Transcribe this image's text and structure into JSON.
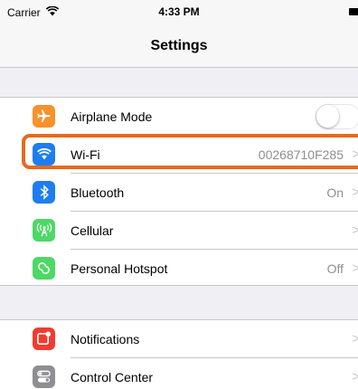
{
  "status_bar": {
    "carrier": "Carrier",
    "time": "4:33 PM"
  },
  "nav": {
    "title": "Settings"
  },
  "colors": {
    "highlight": "#e8691d",
    "airplane": "#f7922d",
    "wifi": "#1e7df2",
    "bluetooth": "#1e7df2",
    "cellular": "#4cd964",
    "hotspot": "#4cd964",
    "notifications": "#f23b30",
    "control_center": "#8e8e93"
  },
  "group1": [
    {
      "label": "Airplane Mode",
      "icon": "airplane-icon",
      "control": "toggle-off"
    },
    {
      "label": "Wi-Fi",
      "icon": "wifi-icon",
      "detail": "00268710F285"
    },
    {
      "label": "Bluetooth",
      "icon": "bluetooth-icon",
      "detail": "On"
    },
    {
      "label": "Cellular",
      "icon": "cellular-antenna-icon",
      "detail": ""
    },
    {
      "label": "Personal Hotspot",
      "icon": "hotspot-link-icon",
      "detail": "Off"
    }
  ],
  "group2": [
    {
      "label": "Notifications",
      "icon": "notifications-icon",
      "detail": ""
    },
    {
      "label": "Control Center",
      "icon": "control-center-icon",
      "detail": ""
    }
  ]
}
